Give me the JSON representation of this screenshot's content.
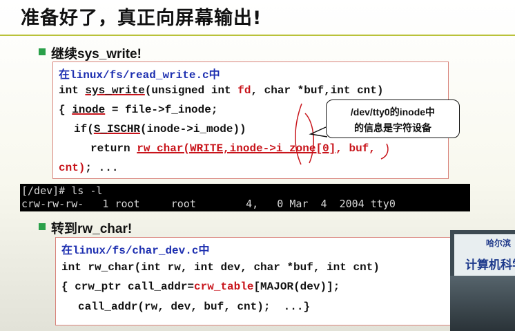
{
  "title": "准备好了，真正向屏幕输出!",
  "section1": {
    "heading": "继续sys_write!",
    "code": {
      "file_prefix": "在",
      "file_path": "linux/fs/read_write.c",
      "file_suffix": "中",
      "line1_a": "int ",
      "line1_fn": "sys_write",
      "line1_b": "(unsigned int ",
      "line1_fd": "fd",
      "line1_c": ", char *buf,int cnt)",
      "line2_a": "{ ",
      "line2_inode": "inode",
      "line2_b": " = file->f_inode;",
      "line3_a": "if(",
      "line3_macro": "S_ISCHR",
      "line3_b": "(inode->i_mode))",
      "line4_a": "return ",
      "line4_red": "rw_char(WRITE,inode->i_zone[0]",
      "line4_b": ", buf,",
      "line5_red": "cnt)",
      "line5_b": "; ..."
    },
    "callout": {
      "line1": "/dev/tty0的inode中",
      "line2": "的信息是字符设备"
    }
  },
  "terminal": {
    "line1": "[/dev]# ls -l",
    "line2": "crw-rw-rw-   1 root     root        4,   0 Mar  4  2004 tty0"
  },
  "section2": {
    "heading": "转到rw_char!",
    "code": {
      "file_prefix": "在",
      "file_path": "linux/fs/char_dev.c",
      "file_suffix": "中",
      "line1": "int rw_char(int rw, int dev, char *buf, int cnt)",
      "line2_a": "{ crw_ptr call_addr=",
      "line2_red": "crw_table",
      "line2_b": "[MAJOR(dev)];",
      "line3": "call_addr(rw, dev, buf, cnt);  ...}"
    }
  },
  "video_inset": {
    "banner_small": "哈尔滨",
    "banner_large": "计算机科学"
  }
}
